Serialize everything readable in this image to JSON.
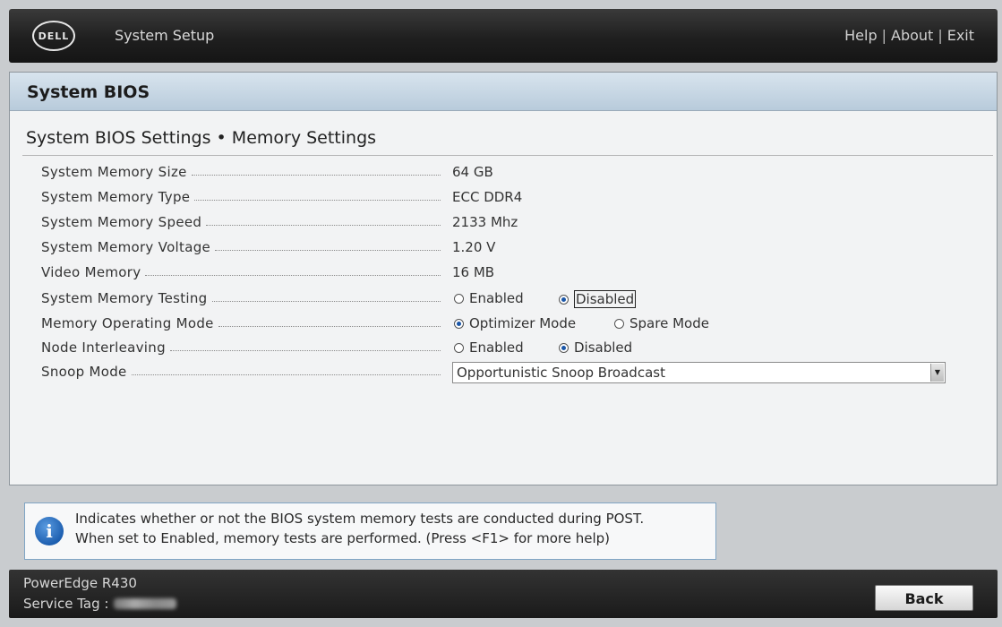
{
  "header": {
    "brand": "DELL",
    "app_title": "System Setup",
    "links": {
      "help": "Help",
      "about": "About",
      "exit": "Exit",
      "separator": "|"
    }
  },
  "section": {
    "title": "System BIOS"
  },
  "page": {
    "title": "System BIOS Settings • Memory Settings"
  },
  "settings": {
    "system_memory_size": {
      "label": "System Memory Size",
      "value": "64 GB"
    },
    "system_memory_type": {
      "label": "System Memory Type",
      "value": "ECC DDR4"
    },
    "system_memory_speed": {
      "label": "System Memory Speed",
      "value": "2133 Mhz"
    },
    "system_memory_voltage": {
      "label": "System Memory Voltage",
      "value": "1.20 V"
    },
    "video_memory": {
      "label": "Video Memory",
      "value": "16 MB"
    },
    "system_memory_testing": {
      "label": "System Memory Testing",
      "options": [
        "Enabled",
        "Disabled"
      ],
      "selected": "Disabled"
    },
    "memory_operating_mode": {
      "label": "Memory Operating Mode",
      "options": [
        "Optimizer Mode",
        "Spare Mode"
      ],
      "selected": "Optimizer Mode"
    },
    "node_interleaving": {
      "label": "Node Interleaving",
      "options": [
        "Enabled",
        "Disabled"
      ],
      "selected": "Disabled"
    },
    "snoop_mode": {
      "label": "Snoop Mode",
      "value": "Opportunistic Snoop Broadcast"
    }
  },
  "help": {
    "line1": "Indicates whether or not the BIOS system memory tests are conducted during POST.",
    "line2": "When set to Enabled, memory tests are performed. (Press <F1> for more help)"
  },
  "footer": {
    "model": "PowerEdge R430",
    "service_tag_label": "Service Tag :",
    "back_label": "Back"
  },
  "colors": {
    "radio_selected": "#1a56a8",
    "section_header": "#c8d7e4",
    "topbar": "#1f1f1f"
  }
}
